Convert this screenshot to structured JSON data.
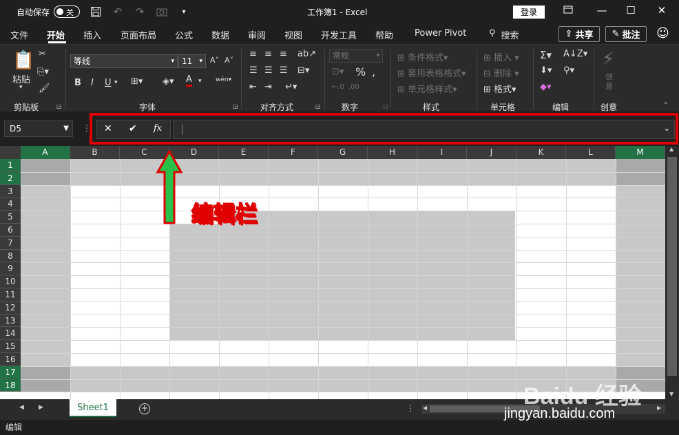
{
  "titlebar": {
    "autosave_label": "自动保存",
    "autosave_state": "关",
    "window_title": "工作簿1  -  Excel",
    "login_label": "登录"
  },
  "tabs": [
    {
      "label": "文件"
    },
    {
      "label": "开始"
    },
    {
      "label": "插入"
    },
    {
      "label": "页面布局"
    },
    {
      "label": "公式"
    },
    {
      "label": "数据"
    },
    {
      "label": "审阅"
    },
    {
      "label": "视图"
    },
    {
      "label": "开发工具"
    },
    {
      "label": "帮助"
    },
    {
      "label": "Power Pivot"
    }
  ],
  "search_label": "搜索",
  "share_label": "共享",
  "comment_label": "批注",
  "ribbon": {
    "paste_label": "粘贴",
    "clipboard_label": "剪贴板",
    "font_name": "等线",
    "font_size": "11",
    "font_group_label": "字体",
    "align_group_label": "对齐方式",
    "number_format": "常规",
    "number_group_label": "数字",
    "cond_format_label": "条件格式",
    "table_format_label": "套用表格格式",
    "cell_style_label": "单元格样式",
    "styles_group_label": "样式",
    "insert_label": "插入",
    "delete_label": "删除",
    "format_label": "格式",
    "cells_group_label": "单元格",
    "edit_group_label": "编辑",
    "create_label": "创意",
    "creativity_group_label": "创意",
    "bold": "B",
    "italic": "I",
    "underline": "U"
  },
  "formula_bar": {
    "name_box": "D5",
    "fx_label": "fx",
    "value": ""
  },
  "columns": [
    "A",
    "B",
    "C",
    "D",
    "E",
    "F",
    "G",
    "H",
    "I",
    "J",
    "K",
    "L",
    "M"
  ],
  "rows": [
    "1",
    "2",
    "3",
    "4",
    "5",
    "6",
    "7",
    "8",
    "9",
    "10",
    "11",
    "12",
    "13",
    "14",
    "15",
    "16",
    "17",
    "18"
  ],
  "annotation_label": "编辑栏",
  "sheet_tab": "Sheet1",
  "status_text": "编辑",
  "watermark": {
    "main": "Baidu 经验",
    "sub": "jingyan.baidu.com"
  },
  "colors": {
    "accent": "#217346",
    "highlight": "#e00000"
  }
}
